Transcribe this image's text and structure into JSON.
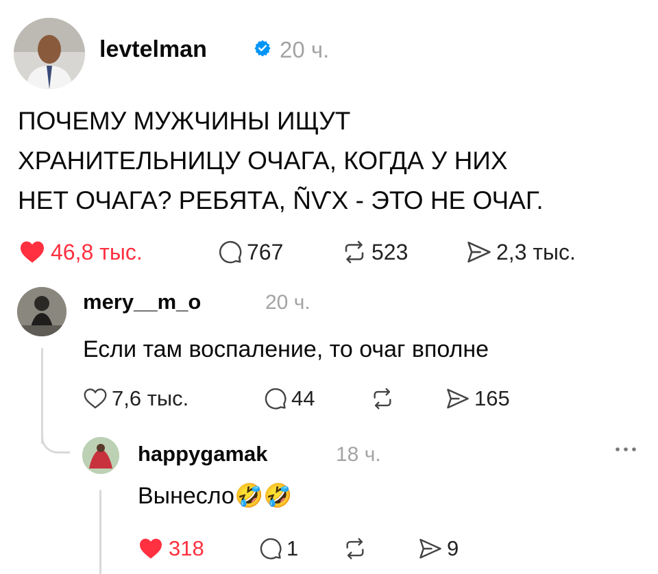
{
  "post": {
    "username": "levtelman",
    "time": "20 ч.",
    "text_lines": [
      "ПОЧЕМУ МУЖЧИНЫ ИЩУТ",
      "ХРАНИТЕЛЬНИЦУ ОЧАГА, КОГДА У НИХ",
      "НЕТ ОЧАГА? РЕБЯТА, ÑѴX - ЭТО НЕ ОЧАГ."
    ],
    "likes": "46,8 тыс.",
    "comments": "767",
    "reposts": "523",
    "shares": "2,3 тыс."
  },
  "reply1": {
    "username": "mery__m_o",
    "time": "20 ч.",
    "text": "Если там воспаление, то очаг вполне",
    "likes": "7,6 тыс.",
    "comments": "44",
    "shares": "165"
  },
  "reply2": {
    "username": "happygamak",
    "time": "18 ч.",
    "text": "Вынесло",
    "emoji": "🤣🤣",
    "likes": "318",
    "comments": "1",
    "shares": "9"
  },
  "colors": {
    "like_active": "#ff3040",
    "verified_blue": "#0095f6",
    "muted": "#a3a3a3"
  },
  "icons": [
    "verified-icon",
    "heart-icon",
    "comment-icon",
    "repost-icon",
    "share-icon",
    "more-icon"
  ]
}
